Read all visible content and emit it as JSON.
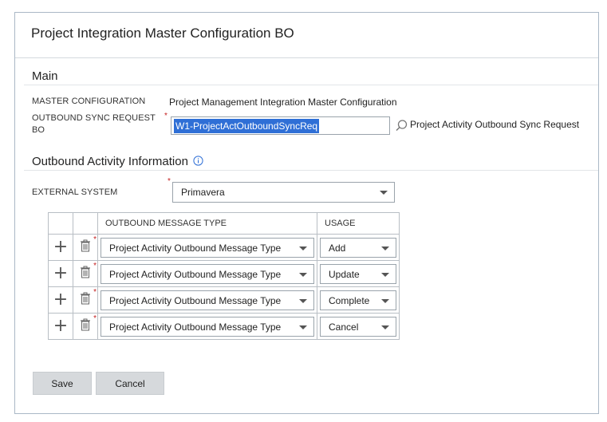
{
  "dialog": {
    "title": "Project Integration Master Configuration BO"
  },
  "main": {
    "section_title": "Main",
    "master_configuration": {
      "label": "MASTER CONFIGURATION",
      "value": "Project Management Integration Master Configuration"
    },
    "outbound_sync": {
      "label_line1": "OUTBOUND SYNC REQUEST",
      "label_line2": "BO",
      "required": "*",
      "value": "W1-ProjectActOutboundSyncReq",
      "description": "Project Activity Outbound Sync Request"
    }
  },
  "outbound_activity": {
    "section_title": "Outbound Activity Information",
    "info_icon": "info-icon",
    "external_system": {
      "label": "EXTERNAL SYSTEM",
      "required": "*",
      "value": "Primavera"
    },
    "grid": {
      "headers": [
        "OUTBOUND MESSAGE TYPE",
        "USAGE"
      ],
      "rows": [
        {
          "message_type": "Project Activity Outbound Message Type",
          "usage": "Add"
        },
        {
          "message_type": "Project Activity Outbound Message Type",
          "usage": "Update"
        },
        {
          "message_type": "Project Activity Outbound Message Type",
          "usage": "Complete"
        },
        {
          "message_type": "Project Activity Outbound Message Type",
          "usage": "Cancel"
        }
      ],
      "add_icon": "plus",
      "delete_icon": "trash-icon",
      "required": "*"
    }
  },
  "buttons": {
    "save": "Save",
    "cancel": "Cancel"
  },
  "colors": {
    "selection": "#2f6fd6",
    "required": "#c41e1e",
    "button": "#d6d9dc",
    "frame_border": "#aab8c6"
  }
}
